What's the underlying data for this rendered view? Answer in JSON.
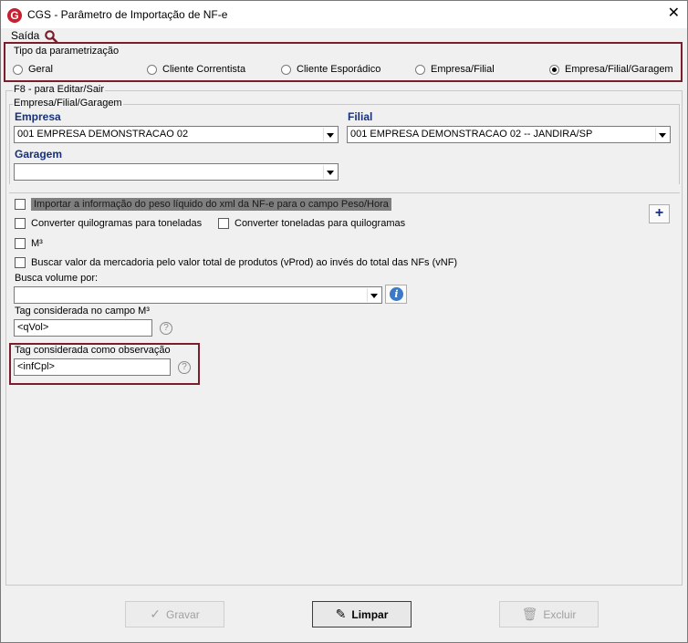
{
  "window": {
    "title": "CGS - Parâmetro de Importação de NF-e",
    "close_label": "✕",
    "app_icon_letter": "G"
  },
  "menu": {
    "saida": "Saída"
  },
  "tipo": {
    "legend": "Tipo da parametrização",
    "options": [
      {
        "label": "Geral",
        "selected": false
      },
      {
        "label": "Cliente Correntista",
        "selected": false
      },
      {
        "label": "Cliente Esporádico",
        "selected": false
      },
      {
        "label": "Empresa/Filial",
        "selected": false
      },
      {
        "label": "Empresa/Filial/Garagem",
        "selected": true
      }
    ]
  },
  "f8_legend": "F8 - para Editar/Sair",
  "efg": {
    "legend": "Empresa/Filial/Garagem",
    "empresa_label": "Empresa",
    "empresa_value": "001 EMPRESA DEMONSTRACAO 02",
    "filial_label": "Filial",
    "filial_value": "001 EMPRESA DEMONSTRACAO 02 -- JANDIRA/SP",
    "garagem_label": "Garagem",
    "garagem_value": ""
  },
  "options": {
    "peso_liquido": "Importar a informação do peso líquido do xml da NF-e para o campo Peso/Hora",
    "kg_to_ton": "Converter quilogramas para toneladas",
    "ton_to_kg": "Converter toneladas para quilogramas",
    "m3": "M³",
    "vprod": "Buscar valor da mercadoria pelo valor total de produtos (vProd) ao invés do total das NFs (vNF)"
  },
  "plus_label": "+",
  "busca": {
    "label": "Busca volume por:",
    "value": ""
  },
  "tag_m3": {
    "label": "Tag considerada no campo M³",
    "value": "<qVol>"
  },
  "tag_obs": {
    "label": "Tag considerada como observação",
    "value": "<infCpl>"
  },
  "help_glyph": "?",
  "info_glyph": "i",
  "buttons": {
    "gravar": "Gravar",
    "limpar": "Limpar",
    "excluir": "Excluir"
  },
  "colors": {
    "highlight_border": "#7b1e2c",
    "label_blue": "#17307a",
    "brand_red": "#c8202f"
  }
}
